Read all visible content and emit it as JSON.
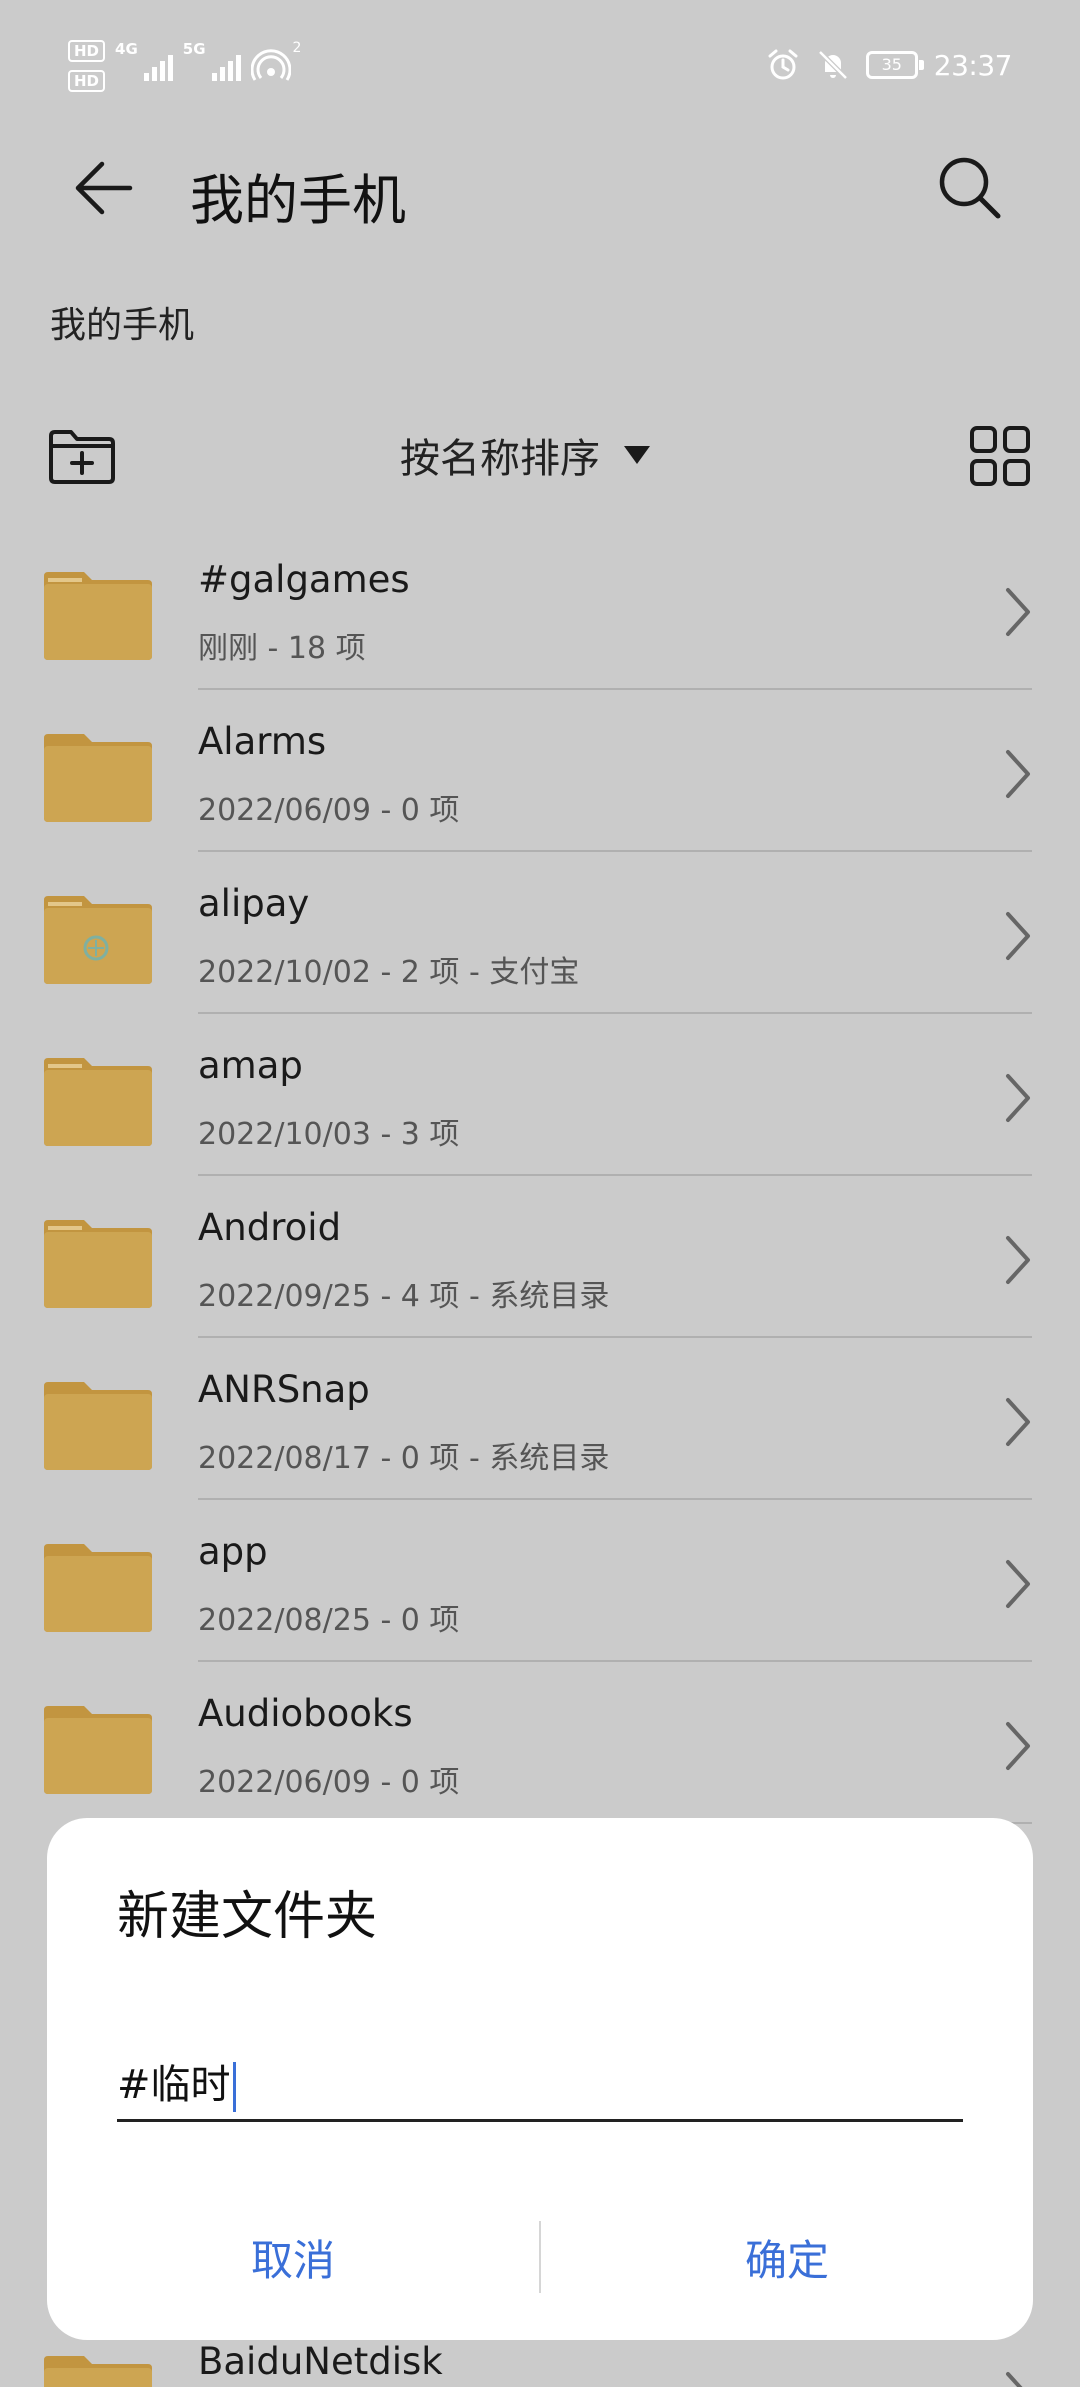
{
  "status_bar": {
    "hd_badges": [
      "HD",
      "HD"
    ],
    "net_label": "4G",
    "net_label_2": "5G",
    "hotspot_count": "2",
    "icons": [
      "alarm-icon",
      "mute-icon"
    ],
    "battery": "35",
    "time": "23:37"
  },
  "app_bar": {
    "title": "我的手机",
    "back_icon": "back-arrow-icon",
    "search_icon": "search-icon"
  },
  "breadcrumb": "我的手机",
  "toolbar": {
    "sort_label": "按名称排序",
    "new_folder_icon": "new-folder-icon",
    "grid_icon": "grid-view-icon"
  },
  "files": [
    {
      "name": "#galgames",
      "meta": "刚刚 - 18 项"
    },
    {
      "name": "Alarms",
      "meta": "2022/06/09 - 0 项"
    },
    {
      "name": "alipay",
      "meta": "2022/10/02 - 2 项 - 支付宝"
    },
    {
      "name": "amap",
      "meta": "2022/10/03 - 3 项"
    },
    {
      "name": "Android",
      "meta": "2022/09/25 - 4 项 - 系统目录"
    },
    {
      "name": "ANRSnap",
      "meta": "2022/08/17 - 0 项 - 系统目录"
    },
    {
      "name": "app",
      "meta": "2022/08/25 - 0 项"
    },
    {
      "name": "Audiobooks",
      "meta": "2022/06/09 - 0 项"
    }
  ],
  "partial_file": {
    "name": "BaiduNetdisk"
  },
  "dialog": {
    "title": "新建文件夹",
    "input_value": "#临时",
    "cancel_label": "取消",
    "confirm_label": "确定"
  },
  "colors": {
    "background": "#cbcbcb",
    "folder": "#cda552",
    "folder_tab": "#c29540",
    "accent": "#3a6fd8"
  }
}
